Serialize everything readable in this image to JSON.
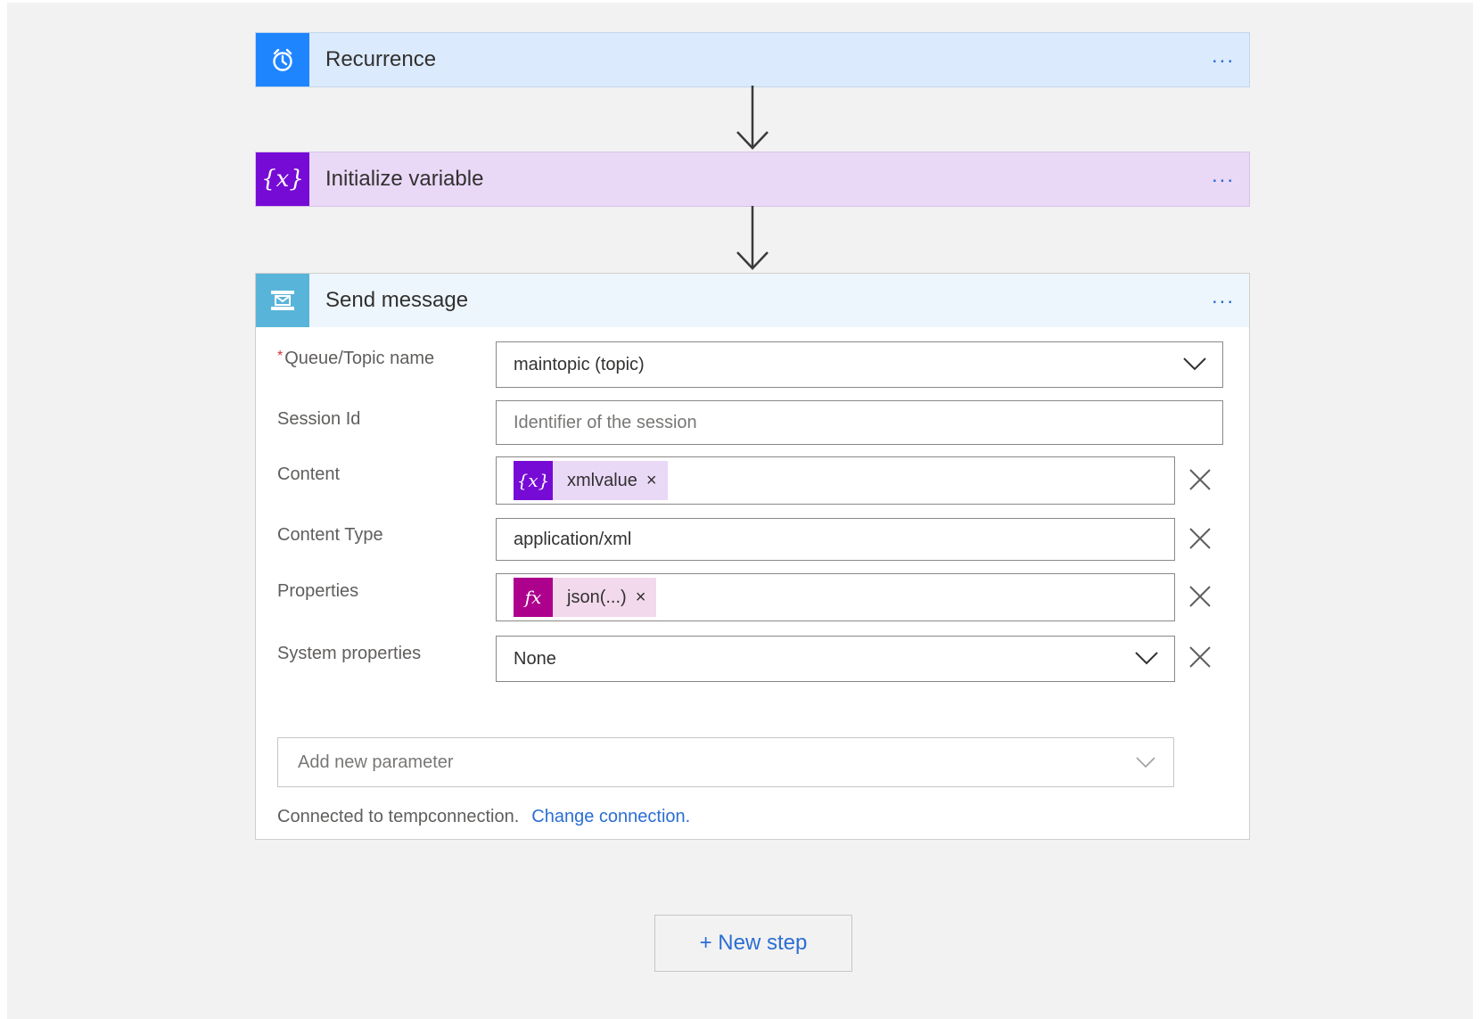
{
  "theme": {
    "recurrence_color": "#1f85ff",
    "recurrence_bg": "#dbeafd",
    "variable_color": "#770bd6",
    "variable_bg": "#ead8f7",
    "servicebus_color": "#59b4d9",
    "expression_color": "#ad008c",
    "expression_bg": "#f2d9ec",
    "link_color": "#2b6ed3"
  },
  "steps": {
    "recurrence": {
      "title": "Recurrence",
      "icon": "alarm-clock-icon",
      "more": "..."
    },
    "init_variable": {
      "title": "Initialize variable",
      "icon": "variable-braces-icon",
      "icon_text": "{x}",
      "more": "..."
    },
    "send_message": {
      "title": "Send message",
      "icon": "service-bus-icon",
      "more": "..."
    }
  },
  "form": {
    "queue_topic": {
      "label": "Queue/Topic name",
      "required": "*",
      "value": "maintopic (topic)"
    },
    "session_id": {
      "label": "Session Id",
      "placeholder": "Identifier of the session"
    },
    "content": {
      "label": "Content",
      "token_icon": "{x}",
      "token_label": "xmlvalue",
      "token_remove": "×"
    },
    "content_type": {
      "label": "Content Type",
      "value": "application/xml"
    },
    "properties": {
      "label": "Properties",
      "token_icon": "fx",
      "token_label": "json(...)",
      "token_remove": "×"
    },
    "system_properties": {
      "label": "System properties",
      "value": "None"
    },
    "add_parameter": {
      "placeholder": "Add new parameter"
    },
    "connection": {
      "text": "Connected to tempconnection.",
      "link": "Change connection."
    }
  },
  "new_step": {
    "label": "+ New step"
  }
}
